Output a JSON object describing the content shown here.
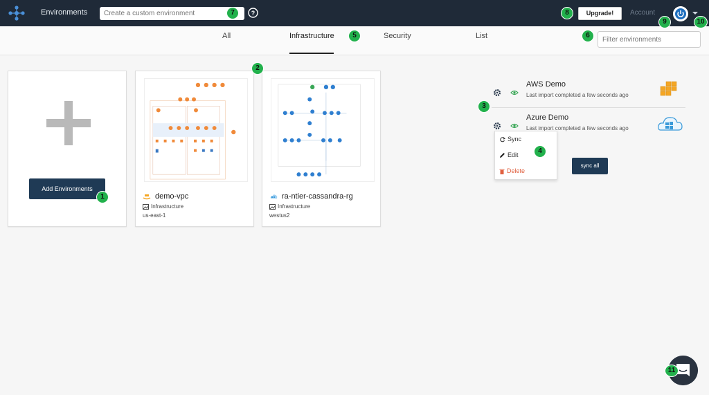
{
  "topbar": {
    "app_title": "Environments",
    "create_placeholder": "Create a custom environment",
    "upgrade_label": "Upgrade!",
    "account_label": "Account",
    "help_icon": "question-circle-icon",
    "avatar_icon": "power-icon",
    "colors": {
      "background": "#1f2a38",
      "logo": "#4a90d9"
    }
  },
  "tabs": {
    "items": [
      {
        "label": "All"
      },
      {
        "label": "Infrastructure"
      },
      {
        "label": "Security"
      },
      {
        "label": "List"
      }
    ],
    "active": "Infrastructure",
    "filter_placeholder": "Filter environments"
  },
  "add_card": {
    "button_label": "Add Environments",
    "icon": "plus-icon"
  },
  "environments": [
    {
      "name": "demo-vpc",
      "provider": "aws",
      "type": "Infrastructure",
      "region": "us-east-1"
    },
    {
      "name": "ra-ntier-cassandra-rg",
      "provider": "azure",
      "type": "Infrastructure",
      "region": "westus2"
    }
  ],
  "sync_panel": {
    "rows": [
      {
        "name": "AWS Demo",
        "status": "Last import completed a few seconds ago",
        "logo": "aws-logo"
      },
      {
        "name": "Azure Demo",
        "status": "Last import completed a few seconds ago",
        "logo": "azure-logo"
      }
    ],
    "menu": [
      {
        "label": "Sync",
        "icon": "refresh-icon"
      },
      {
        "label": "Edit",
        "icon": "pencil-icon"
      },
      {
        "label": "Delete",
        "icon": "trash-icon"
      }
    ],
    "sync_all_label": "sync all",
    "colors": {
      "eye": "#3aa757",
      "delete": "#e0603f",
      "aws": "#f5a623",
      "azure": "#3a9ad9"
    }
  },
  "callouts": [
    "1",
    "2",
    "3",
    "4",
    "5",
    "6",
    "7",
    "8",
    "9",
    "10",
    "11"
  ],
  "chat_icon": "chat-icon"
}
